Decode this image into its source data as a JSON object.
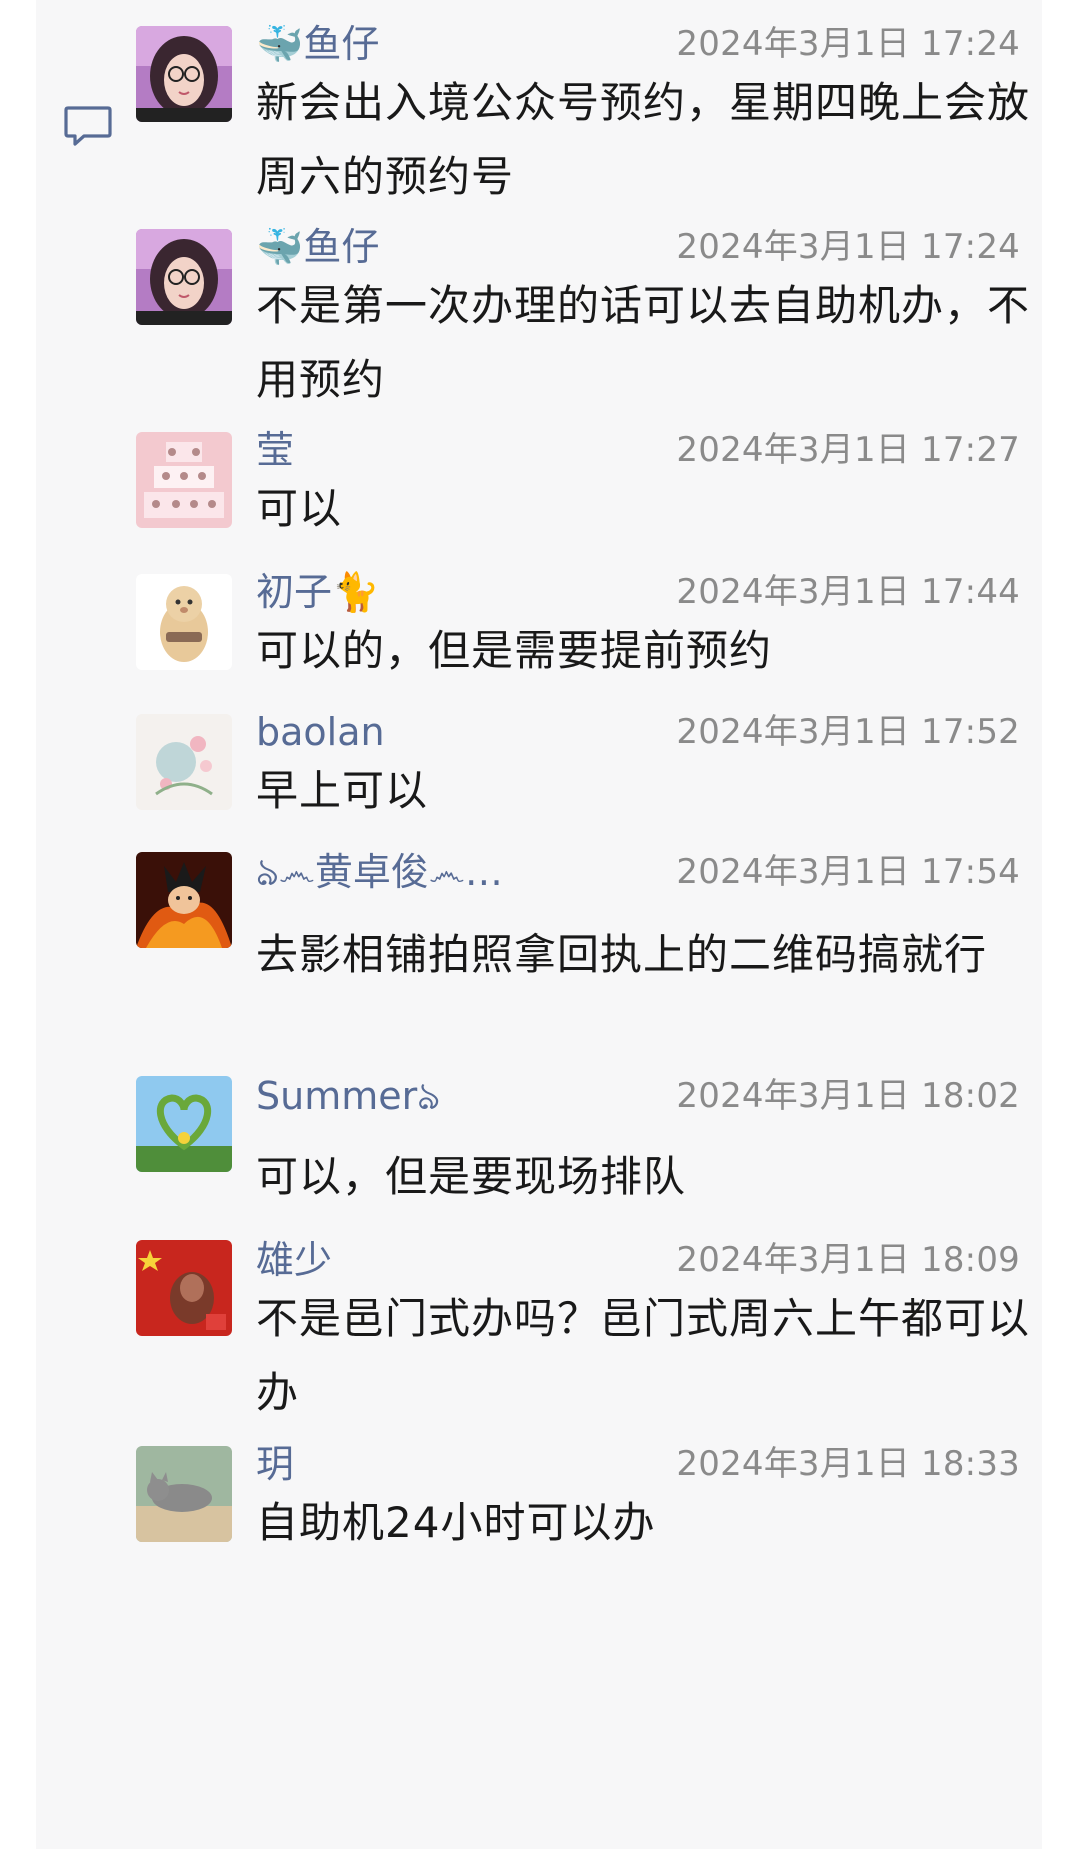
{
  "comments": [
    {
      "name": "🐳鱼仔",
      "time": "2024年3月1日 17:24",
      "text": "新会出入境公众号预约，星期四晚上会放周六的预约号",
      "avatar_icon": "girl-with-glasses-avatar"
    },
    {
      "name": "🐳鱼仔",
      "time": "2024年3月1日 17:24",
      "text": "不是第一次办理的话可以去自助机办，不用预约",
      "avatar_icon": "girl-with-glasses-avatar"
    },
    {
      "name": "莹",
      "time": "2024年3月1日 17:27",
      "text": "可以",
      "avatar_icon": "pink-collage-avatar"
    },
    {
      "name": "初子🐈",
      "time": "2024年3月1日 17:44",
      "text": "可以的，但是需要提前预约",
      "avatar_icon": "cartoon-hamster-avatar"
    },
    {
      "name": "baolan",
      "time": "2024年3月1日 17:52",
      "text": "早上可以",
      "avatar_icon": "floral-illustration-avatar"
    },
    {
      "name": "ঌ෴黄卓俊෴…",
      "time": "2024年3月1日 17:54",
      "text": "去影相铺拍照拿回执上的二维码搞就行",
      "avatar_icon": "anime-fire-hero-avatar"
    },
    {
      "name": "Summerঌ",
      "time": "2024年3月1日 18:02",
      "text": "可以，但是要现场排队",
      "avatar_icon": "cactus-heart-avatar"
    },
    {
      "name": "雄少",
      "time": "2024年3月1日 18:09",
      "text": "不是邑门式办吗？邑门式周六上午都可以办",
      "avatar_icon": "red-flag-portrait-avatar"
    },
    {
      "name": "玥",
      "time": "2024年3月1日 18:33",
      "text": "自助机24小时可以办",
      "avatar_icon": "cat-on-box-avatar"
    }
  ],
  "colors": {
    "name": "#576b95",
    "time": "#8a8a8a",
    "text": "#191919",
    "panel_background": "#f7f7f8"
  }
}
